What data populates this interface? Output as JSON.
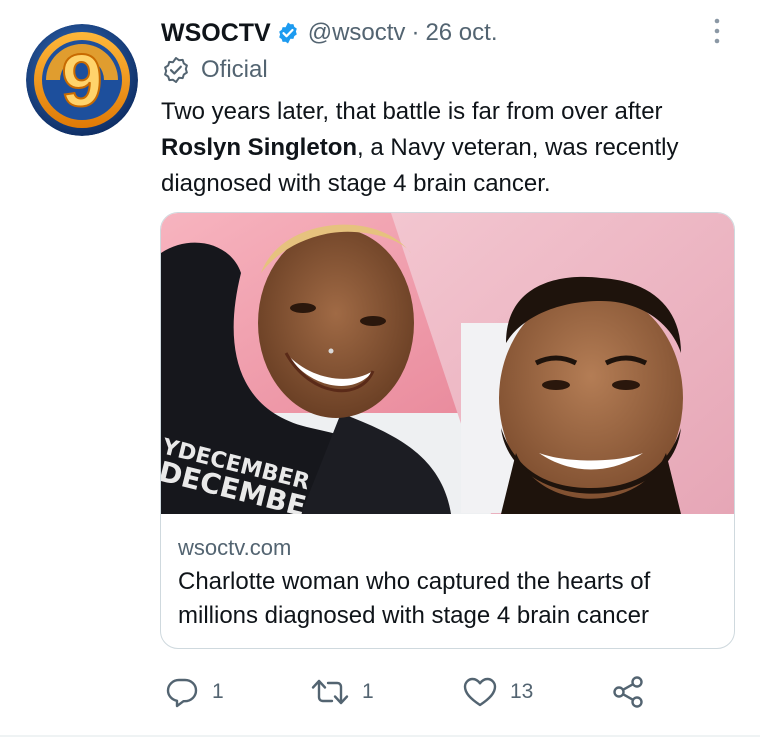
{
  "tweet": {
    "author_name": "WSOCTV",
    "handle": "@wsoctv",
    "separator": "·",
    "date": "26 oct.",
    "label": "Oficial",
    "text_part1": "Two years later, that battle is far from over after ",
    "text_bold": "Roslyn Singleton",
    "text_part2": ", a Navy veteran, was recently diagnosed with stage 4 brain cancer.",
    "avatar_numeral": "9"
  },
  "card": {
    "domain": "wsoctv.com",
    "title": "Charlotte woman who captured the hearts of millions diagnosed with stage 4 brain cancer",
    "image_shirt_text_1": "YDECEMBER",
    "image_shirt_text_2": "DECEMBE"
  },
  "actions": {
    "reply_count": "1",
    "retweet_count": "1",
    "like_count": "13"
  },
  "icons": {
    "verified": "verified-badge-icon",
    "official": "official-badge-icon",
    "more": "more-vertical-icon",
    "reply": "reply-icon",
    "retweet": "retweet-icon",
    "like": "heart-icon",
    "share": "share-icon"
  },
  "colors": {
    "verified_blue": "#1d9bf0",
    "text_primary": "#0f1419",
    "text_secondary": "#536471",
    "avatar_orange": "#f39a12",
    "avatar_blue": "#1d4f9c"
  }
}
